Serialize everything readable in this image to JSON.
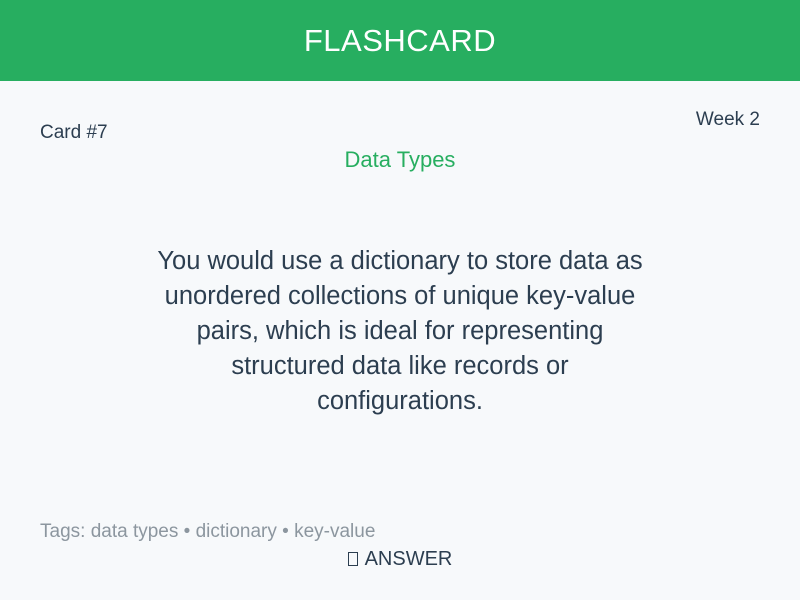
{
  "header": {
    "title": "FLASHCARD",
    "background_color": "#27ae60"
  },
  "card": {
    "number_label": "Card #7",
    "week_label": "Week 2",
    "category": "Data Types",
    "answer_text": "You would use a dictionary to store data as unordered collections of unique key-value pairs, which is ideal for representing structured data like records or configurations.",
    "tags_label": "Tags: data types • dictionary • key-value",
    "side_icon": "card-glyph-icon",
    "side_label": "ANSWER"
  },
  "colors": {
    "accent": "#27ae60",
    "text": "#2c3e50",
    "muted": "#8c969f",
    "background": "#f7f9fb"
  }
}
